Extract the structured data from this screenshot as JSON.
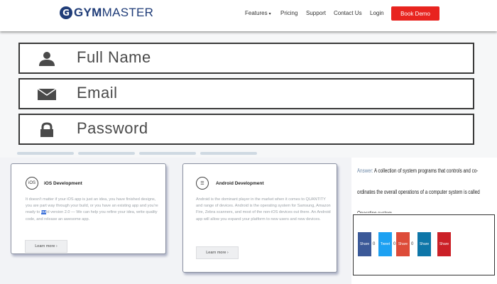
{
  "header": {
    "logo_bold": "GYM",
    "logo_light": "MASTER",
    "logo_mark": "G",
    "nav": [
      {
        "label": "Features",
        "has_dropdown": true
      },
      {
        "label": "Pricing"
      },
      {
        "label": "Support"
      },
      {
        "label": "Contact Us"
      },
      {
        "label": "Login"
      }
    ],
    "cta_label": "Book Demo",
    "cta_color": "#e8241f",
    "brand_color": "#1f3c78"
  },
  "form": {
    "fields": [
      {
        "label": "Full Name",
        "icon": "user-icon"
      },
      {
        "label": "Email",
        "icon": "envelope-icon"
      },
      {
        "label": "Password",
        "icon": "lock-icon"
      }
    ]
  },
  "cards": [
    {
      "title": "iOS Development",
      "icon_text": "iOS",
      "body_before": "It doesn't matter if your iOS app is just an idea, you have finished designs, you are part way through your build, or you have an existing app and you're ready to ",
      "body_highlight": "bui",
      "body_after": "ld version 2.0 — We can help you refine your idea, write quality code, and release an awesome app.",
      "button_label": "Learn more ›"
    },
    {
      "title": "Android Development",
      "icon_text": "☰",
      "body": "Android is the dominant player in the market when it comes to QUANTITY and range of devices. Android is the operating system for Samsung, Amazon Fire, Zebra scanners, and most of the non-iOS devices out there. An Android app will allow you expand your platform to new users and new devices.",
      "button_label": "Learn more ›"
    }
  ],
  "answer": {
    "label": "Answer:",
    "text": " A collection of system programs that controls and co-ordinates the overall operations of a computer system is called Operating system."
  },
  "share": {
    "buttons": [
      {
        "label": "Share",
        "icon": "facebook-icon",
        "color": "#3b5998",
        "count": "0"
      },
      {
        "label": "Tweet",
        "icon": "twitter-icon",
        "color": "#1da1f2",
        "count": "0"
      },
      {
        "label": "Share",
        "icon": "google-plus-icon",
        "color": "#dd4b39",
        "count": "0"
      },
      {
        "label": "Share",
        "icon": "linkedin-icon",
        "color": "#0e76a8",
        "count": ""
      },
      {
        "label": "Share",
        "icon": "pinterest-icon",
        "color": "#cb2027",
        "count": ""
      }
    ]
  }
}
